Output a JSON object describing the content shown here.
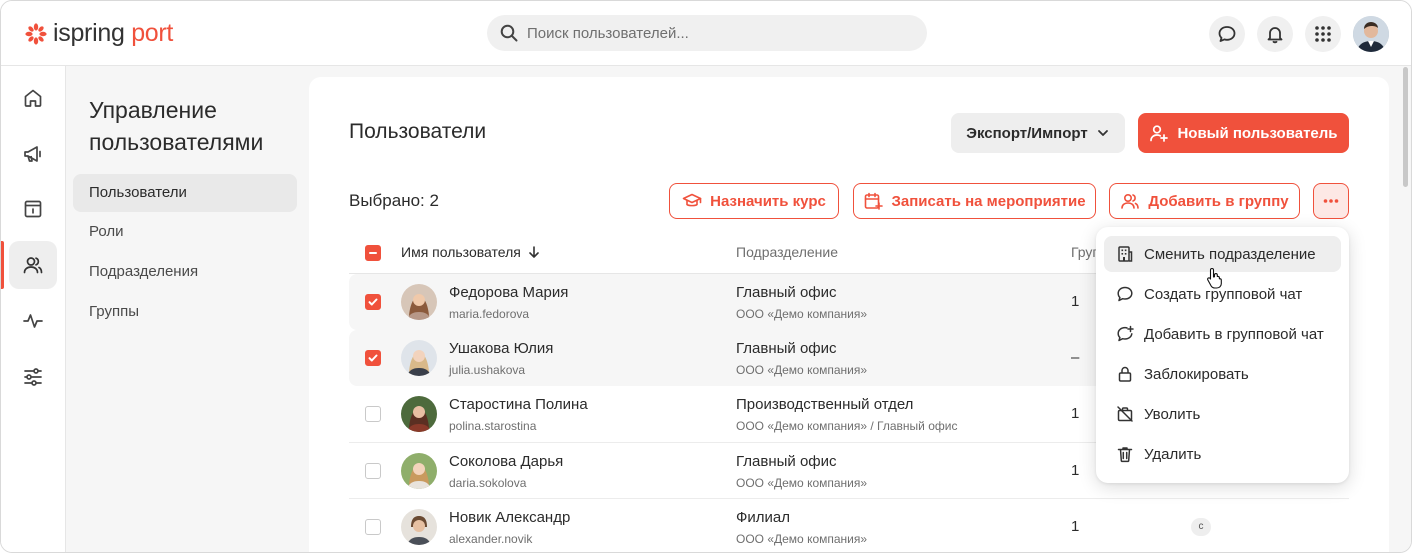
{
  "app": {
    "logo_text_main": "ispring",
    "logo_text_accent": "port",
    "search_placeholder": "Поиск пользователей..."
  },
  "colors": {
    "accent": "#f0513c",
    "sidebar_bg": "#f6f6f6",
    "text_primary": "#2b2b2b",
    "text_secondary": "#6f6f6f"
  },
  "topbar_icons": [
    "chat-icon",
    "bell-icon",
    "apps-grid-icon",
    "user-avatar"
  ],
  "rail": [
    {
      "name": "home-icon",
      "active": false
    },
    {
      "name": "megaphone-icon",
      "active": false
    },
    {
      "name": "catalog-icon",
      "active": false
    },
    {
      "name": "users-icon",
      "active": true
    },
    {
      "name": "activity-icon",
      "active": false
    },
    {
      "name": "settings-sliders-icon",
      "active": false
    }
  ],
  "section": {
    "title": "Управление пользователями",
    "items": [
      {
        "label": "Пользователи",
        "active": true
      },
      {
        "label": "Роли",
        "active": false
      },
      {
        "label": "Подразделения",
        "active": false
      },
      {
        "label": "Группы",
        "active": false
      }
    ]
  },
  "main": {
    "title": "Пользователи",
    "export_label": "Экспорт/Импорт",
    "new_user_label": "Новый пользователь",
    "selected_label": "Выбрано: 2",
    "actions": {
      "assign_course": "Назначить курс",
      "enroll_event": "Записать на мероприятие",
      "add_to_group": "Добавить в группу"
    },
    "columns": {
      "name": "Имя пользователя",
      "department": "Подразделение",
      "groups": "Груп"
    },
    "rows": [
      {
        "name": "Федорова Мария",
        "login": "maria.fedorova",
        "department": "Главный офис",
        "org": "ООО «Демо компания»",
        "groups": "1",
        "checked": true
      },
      {
        "name": "Ушакова Юлия",
        "login": "julia.ushakova",
        "department": "Главный офис",
        "org": "ООО «Демо компания»",
        "groups": "–",
        "checked": true
      },
      {
        "name": "Старостина Полина",
        "login": "polina.starostina",
        "department": "Производственный отдел",
        "org": "ООО «Демо компания» / Главный офис",
        "groups": "1",
        "checked": false
      },
      {
        "name": "Соколова Дарья",
        "login": "daria.sokolova",
        "department": "Главный офис",
        "org": "ООО «Демо компания»",
        "groups": "1",
        "checked": false
      },
      {
        "name": "Новик Александр",
        "login": "alexander.novik",
        "department": "Филиал",
        "org": "ООО «Демо компания»",
        "groups": "1",
        "checked": false,
        "tag": "с"
      }
    ]
  },
  "menu": {
    "items": [
      {
        "label": "Сменить подразделение",
        "icon": "building-icon",
        "hover": true
      },
      {
        "label": "Создать групповой чат",
        "icon": "chat-bubble-icon",
        "hover": false
      },
      {
        "label": "Добавить в групповой чат",
        "icon": "chat-add-icon",
        "hover": false
      },
      {
        "label": "Заблокировать",
        "icon": "lock-icon",
        "hover": false
      },
      {
        "label": "Уволить",
        "icon": "dismiss-briefcase-icon",
        "hover": false
      },
      {
        "label": "Удалить",
        "icon": "trash-icon",
        "hover": false
      }
    ]
  }
}
